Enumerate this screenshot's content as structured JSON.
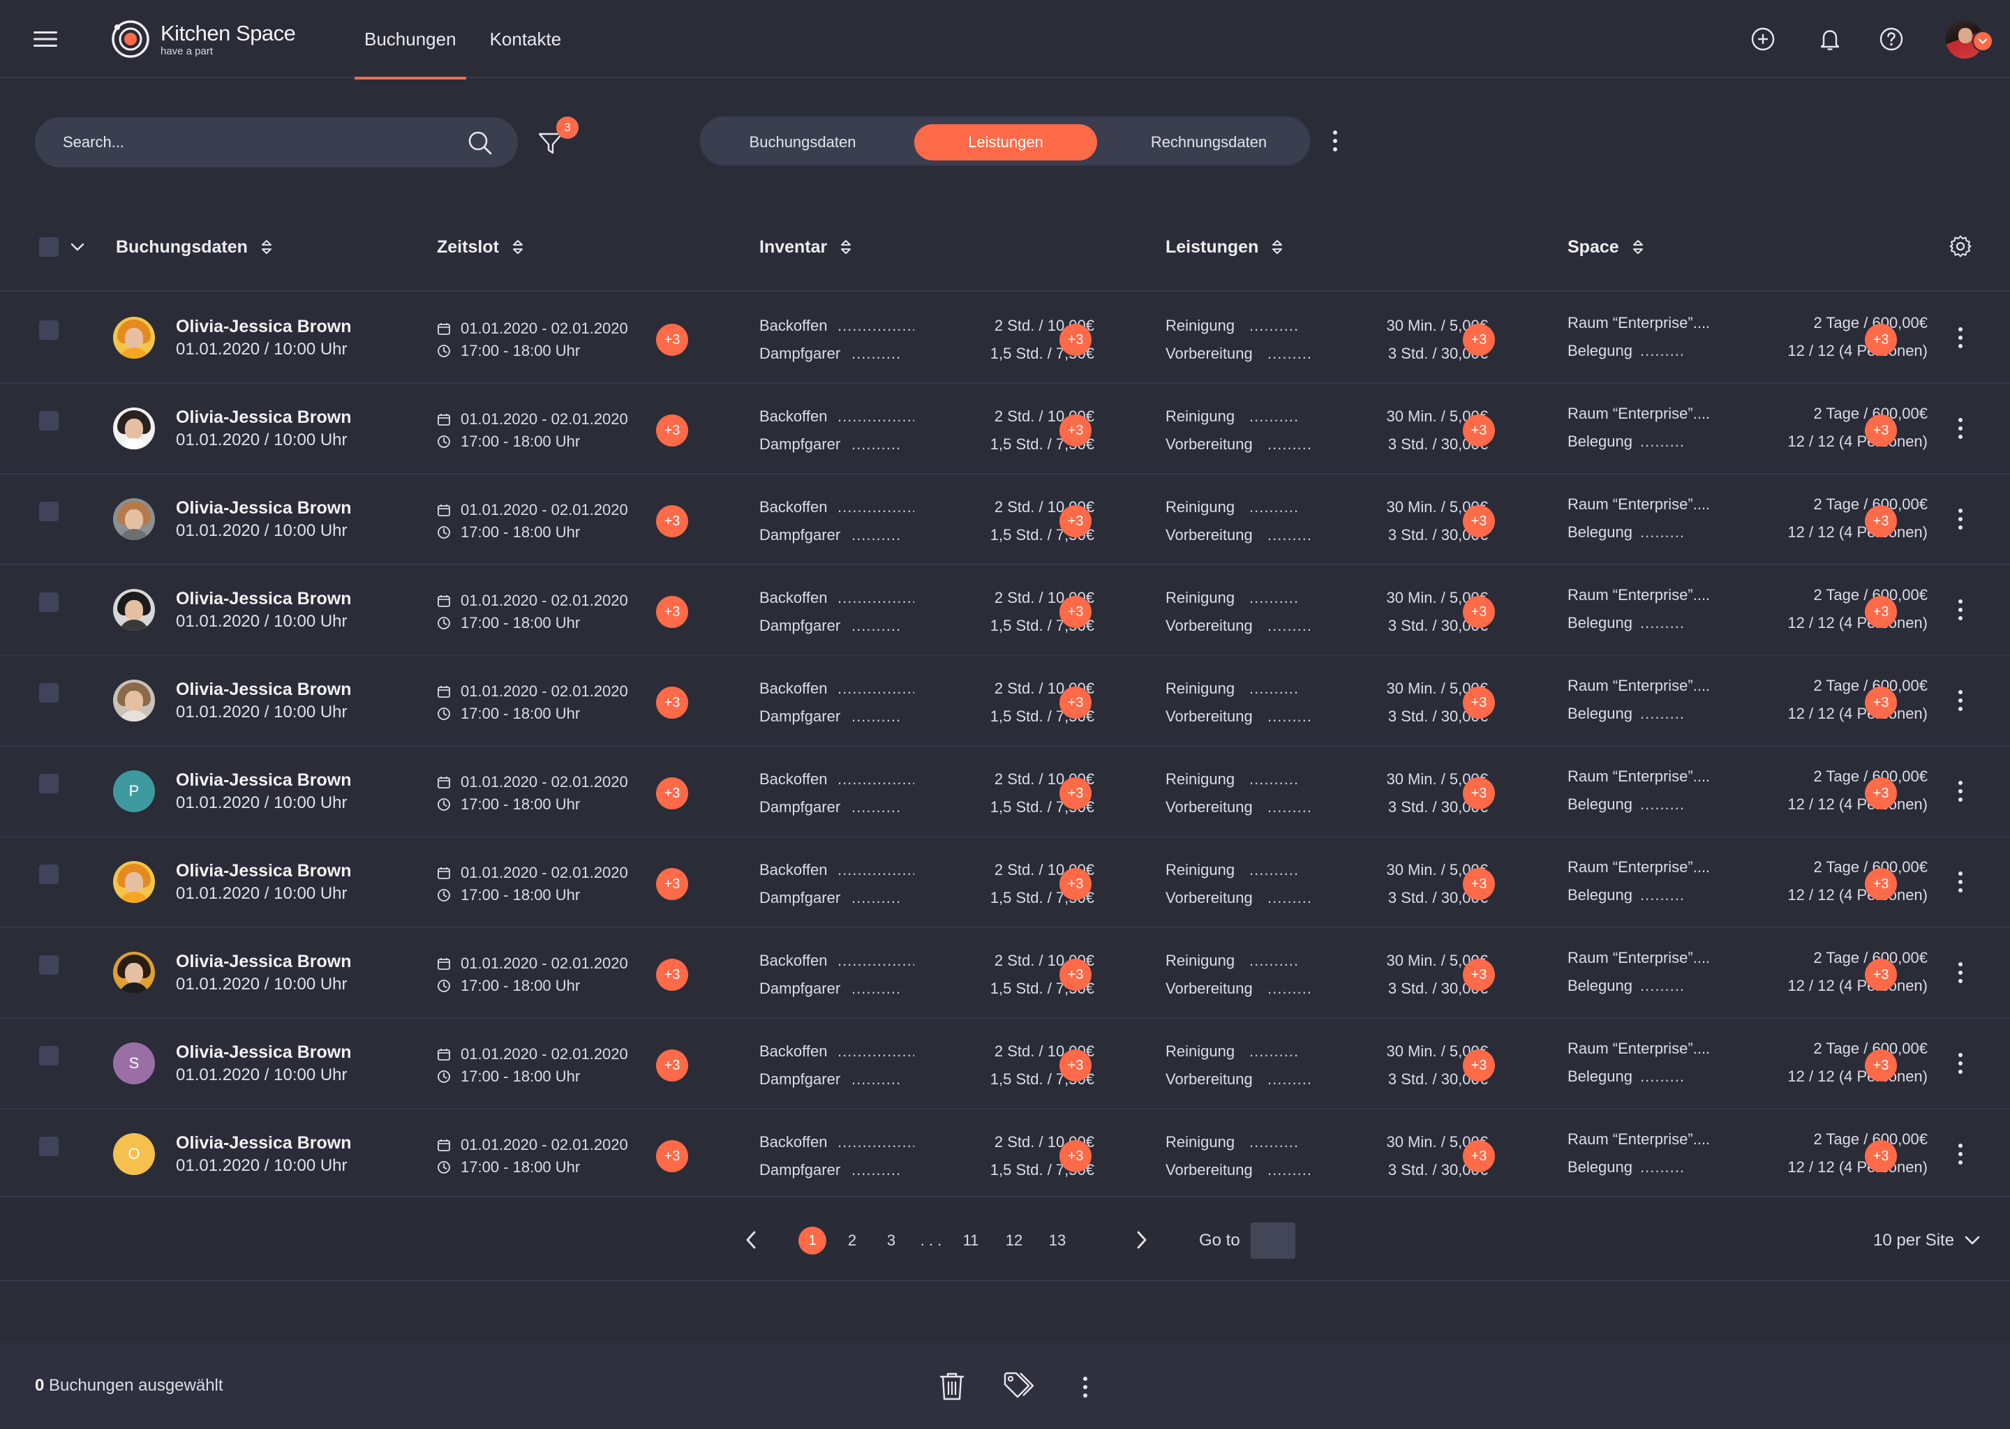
{
  "app": {
    "title": "Kitchen Space",
    "subtitle": "have a part",
    "accent_color": "#ff6a48",
    "background_color": "#2a2c38"
  },
  "nav": {
    "tabs": [
      {
        "label": "Buchungen",
        "active": true
      },
      {
        "label": "Kontakte",
        "active": false
      }
    ]
  },
  "header_icons": [
    "plus-circle-icon",
    "bell-icon",
    "help-icon",
    "user-avatar"
  ],
  "search": {
    "placeholder": "Search...",
    "value": ""
  },
  "filter": {
    "badge_count": "3"
  },
  "view_tabs": [
    {
      "label": "Buchungsdaten",
      "active": false
    },
    {
      "label": "Leistungen",
      "active": true
    },
    {
      "label": "Rechnungsdaten",
      "active": false
    }
  ],
  "columns": [
    "Buchungsdaten",
    "Zeitslot",
    "Inventar",
    "Leistungen",
    "Space"
  ],
  "rows": [
    {
      "name": "Olivia-Jessica Brown",
      "date": "01.01.2020  /  10:00 Uhr",
      "avatar": {
        "type": "photo",
        "hair": "#e58a1f",
        "bg": "#f3c54a",
        "body": "#f6a623"
      },
      "dates": "01.01.2020 - 02.01.2020",
      "time": "17:00 - 18:00 Uhr",
      "more_time": "+3",
      "inventar": [
        {
          "label": "Backoffen",
          "dots": "................",
          "value": "2 Std.  /  10,00€"
        },
        {
          "label": "Dampfgarer",
          "dots": "..........",
          "value": "1,5 Std.  /  7,50€"
        }
      ],
      "more_inventar": "+3",
      "leistungen": [
        {
          "label": "Reinigung",
          "dots": "..........",
          "value": "30 Min.  /  5,00€"
        },
        {
          "label": "Vorbereitung",
          "dots": ".........",
          "value": "3 Std.  /  30,00€"
        }
      ],
      "more_leistungen": "+3",
      "space": [
        {
          "label": "Raum “Enterprise”....",
          "dots": "",
          "value": "2 Tage  /  600,00€"
        },
        {
          "label": "Belegung",
          "dots": ".........",
          "value": "12 / 12 (4 Personen)"
        }
      ],
      "more_space": "+3"
    },
    {
      "name": "Olivia-Jessica Brown",
      "date": "01.01.2020  /  10:00 Uhr",
      "avatar": {
        "type": "photo",
        "hair": "#2a2220",
        "bg": "#f0f0f0",
        "body": "#ffffff"
      },
      "dates": "01.01.2020 - 02.01.2020",
      "time": "17:00 - 18:00 Uhr",
      "more_time": "+3",
      "inventar": [
        {
          "label": "Backoffen",
          "dots": "................",
          "value": "2 Std.  /  10,00€"
        },
        {
          "label": "Dampfgarer",
          "dots": "..........",
          "value": "1,5 Std.  /  7,50€"
        }
      ],
      "more_inventar": "+3",
      "leistungen": [
        {
          "label": "Reinigung",
          "dots": "..........",
          "value": "30 Min.  /  5,00€"
        },
        {
          "label": "Vorbereitung",
          "dots": ".........",
          "value": "3 Std.  /  30,00€"
        }
      ],
      "more_leistungen": "+3",
      "space": [
        {
          "label": "Raum “Enterprise”....",
          "dots": "",
          "value": "2 Tage  /  600,00€"
        },
        {
          "label": "Belegung",
          "dots": ".........",
          "value": "12 / 12 (4 Personen)"
        }
      ],
      "more_space": "+3"
    },
    {
      "name": "Olivia-Jessica Brown",
      "date": "01.01.2020  /  10:00 Uhr",
      "avatar": {
        "type": "photo",
        "hair": "#b57a4a",
        "bg": "#8a8f94",
        "body": "#6c6f74"
      },
      "dates": "01.01.2020 - 02.01.2020",
      "time": "17:00 - 18:00 Uhr",
      "more_time": "+3",
      "inventar": [
        {
          "label": "Backoffen",
          "dots": "................",
          "value": "2 Std.  /  10,00€"
        },
        {
          "label": "Dampfgarer",
          "dots": "..........",
          "value": "1,5 Std.  /  7,50€"
        }
      ],
      "more_inventar": "+3",
      "leistungen": [
        {
          "label": "Reinigung",
          "dots": "..........",
          "value": "30 Min.  /  5,00€"
        },
        {
          "label": "Vorbereitung",
          "dots": ".........",
          "value": "3 Std.  /  30,00€"
        }
      ],
      "more_leistungen": "+3",
      "space": [
        {
          "label": "Raum “Enterprise”....",
          "dots": "",
          "value": "2 Tage  /  600,00€"
        },
        {
          "label": "Belegung",
          "dots": ".........",
          "value": "12 / 12 (4 Personen)"
        }
      ],
      "more_space": "+3"
    },
    {
      "name": "Olivia-Jessica Brown",
      "date": "01.01.2020  /  10:00 Uhr",
      "avatar": {
        "type": "photo",
        "hair": "#1c1c1c",
        "bg": "#d7d7d7",
        "body": "#3a3a3a"
      },
      "dates": "01.01.2020 - 02.01.2020",
      "time": "17:00 - 18:00 Uhr",
      "more_time": "+3",
      "inventar": [
        {
          "label": "Backoffen",
          "dots": "................",
          "value": "2 Std.  /  10,00€"
        },
        {
          "label": "Dampfgarer",
          "dots": "..........",
          "value": "1,5 Std.  /  7,50€"
        }
      ],
      "more_inventar": "+3",
      "leistungen": [
        {
          "label": "Reinigung",
          "dots": "..........",
          "value": "30 Min.  /  5,00€"
        },
        {
          "label": "Vorbereitung",
          "dots": ".........",
          "value": "3 Std.  /  30,00€"
        }
      ],
      "more_leistungen": "+3",
      "space": [
        {
          "label": "Raum “Enterprise”....",
          "dots": "",
          "value": "2 Tage  /  600,00€"
        },
        {
          "label": "Belegung",
          "dots": ".........",
          "value": "12 / 12 (4 Personen)"
        }
      ],
      "more_space": "+3"
    },
    {
      "name": "Olivia-Jessica Brown",
      "date": "01.01.2020  /  10:00 Uhr",
      "avatar": {
        "type": "photo",
        "hair": "#8b6a4a",
        "bg": "#c9c2b8",
        "body": "#e6e1da"
      },
      "dates": "01.01.2020 - 02.01.2020",
      "time": "17:00 - 18:00 Uhr",
      "more_time": "+3",
      "inventar": [
        {
          "label": "Backoffen",
          "dots": "................",
          "value": "2 Std.  /  10,00€"
        },
        {
          "label": "Dampfgarer",
          "dots": "..........",
          "value": "1,5 Std.  /  7,50€"
        }
      ],
      "more_inventar": "+3",
      "leistungen": [
        {
          "label": "Reinigung",
          "dots": "..........",
          "value": "30 Min.  /  5,00€"
        },
        {
          "label": "Vorbereitung",
          "dots": ".........",
          "value": "3 Std.  /  30,00€"
        }
      ],
      "more_leistungen": "+3",
      "space": [
        {
          "label": "Raum “Enterprise”....",
          "dots": "",
          "value": "2 Tage  /  600,00€"
        },
        {
          "label": "Belegung",
          "dots": ".........",
          "value": "12 / 12 (4 Personen)"
        }
      ],
      "more_space": "+3"
    },
    {
      "name": "Olivia-Jessica Brown",
      "date": "01.01.2020  /  10:00 Uhr",
      "avatar": {
        "type": "initial",
        "initial": "P",
        "bg": "#3f9aa0"
      },
      "dates": "01.01.2020 - 02.01.2020",
      "time": "17:00 - 18:00 Uhr",
      "more_time": "+3",
      "inventar": [
        {
          "label": "Backoffen",
          "dots": "................",
          "value": "2 Std.  /  10,00€"
        },
        {
          "label": "Dampfgarer",
          "dots": "..........",
          "value": "1,5 Std.  /  7,50€"
        }
      ],
      "more_inventar": "+3",
      "leistungen": [
        {
          "label": "Reinigung",
          "dots": "..........",
          "value": "30 Min.  /  5,00€"
        },
        {
          "label": "Vorbereitung",
          "dots": ".........",
          "value": "3 Std.  /  30,00€"
        }
      ],
      "more_leistungen": "+3",
      "space": [
        {
          "label": "Raum “Enterprise”....",
          "dots": "",
          "value": "2 Tage  /  600,00€"
        },
        {
          "label": "Belegung",
          "dots": ".........",
          "value": "12 / 12 (4 Personen)"
        }
      ],
      "more_space": "+3"
    },
    {
      "name": "Olivia-Jessica Brown",
      "date": "01.01.2020  /  10:00 Uhr",
      "avatar": {
        "type": "photo",
        "hair": "#e58a1f",
        "bg": "#f3c54a",
        "body": "#f6a623"
      },
      "dates": "01.01.2020 - 02.01.2020",
      "time": "17:00 - 18:00 Uhr",
      "more_time": "+3",
      "inventar": [
        {
          "label": "Backoffen",
          "dots": "................",
          "value": "2 Std.  /  10,00€"
        },
        {
          "label": "Dampfgarer",
          "dots": "..........",
          "value": "1,5 Std.  /  7,50€"
        }
      ],
      "more_inventar": "+3",
      "leistungen": [
        {
          "label": "Reinigung",
          "dots": "..........",
          "value": "30 Min.  /  5,00€"
        },
        {
          "label": "Vorbereitung",
          "dots": ".........",
          "value": "3 Std.  /  30,00€"
        }
      ],
      "more_leistungen": "+3",
      "space": [
        {
          "label": "Raum “Enterprise”....",
          "dots": "",
          "value": "2 Tage  /  600,00€"
        },
        {
          "label": "Belegung",
          "dots": ".........",
          "value": "12 / 12 (4 Personen)"
        }
      ],
      "more_space": "+3"
    },
    {
      "name": "Olivia-Jessica Brown",
      "date": "01.01.2020  /  10:00 Uhr",
      "avatar": {
        "type": "photo",
        "hair": "#2a1e14",
        "bg": "#e0a030",
        "body": "#1d1d1d"
      },
      "dates": "01.01.2020 - 02.01.2020",
      "time": "17:00 - 18:00 Uhr",
      "more_time": "+3",
      "inventar": [
        {
          "label": "Backoffen",
          "dots": "................",
          "value": "2 Std.  /  10,00€"
        },
        {
          "label": "Dampfgarer",
          "dots": "..........",
          "value": "1,5 Std.  /  7,50€"
        }
      ],
      "more_inventar": "+3",
      "leistungen": [
        {
          "label": "Reinigung",
          "dots": "..........",
          "value": "30 Min.  /  5,00€"
        },
        {
          "label": "Vorbereitung",
          "dots": ".........",
          "value": "3 Std.  /  30,00€"
        }
      ],
      "more_leistungen": "+3",
      "space": [
        {
          "label": "Raum “Enterprise”....",
          "dots": "",
          "value": "2 Tage  /  600,00€"
        },
        {
          "label": "Belegung",
          "dots": ".........",
          "value": "12 / 12 (4 Personen)"
        }
      ],
      "more_space": "+3"
    },
    {
      "name": "Olivia-Jessica Brown",
      "date": "01.01.2020  /  10:00 Uhr",
      "avatar": {
        "type": "initial",
        "initial": "S",
        "bg": "#9a6fa6"
      },
      "dates": "01.01.2020 - 02.01.2020",
      "time": "17:00 - 18:00 Uhr",
      "more_time": "+3",
      "inventar": [
        {
          "label": "Backoffen",
          "dots": "................",
          "value": "2 Std.  /  10,00€"
        },
        {
          "label": "Dampfgarer",
          "dots": "..........",
          "value": "1,5 Std.  /  7,50€"
        }
      ],
      "more_inventar": "+3",
      "leistungen": [
        {
          "label": "Reinigung",
          "dots": "..........",
          "value": "30 Min.  /  5,00€"
        },
        {
          "label": "Vorbereitung",
          "dots": ".........",
          "value": "3 Std.  /  30,00€"
        }
      ],
      "more_leistungen": "+3",
      "space": [
        {
          "label": "Raum “Enterprise”....",
          "dots": "",
          "value": "2 Tage  /  600,00€"
        },
        {
          "label": "Belegung",
          "dots": ".........",
          "value": "12 / 12 (4 Personen)"
        }
      ],
      "more_space": "+3"
    },
    {
      "name": "Olivia-Jessica Brown",
      "date": "01.01.2020  /  10:00 Uhr",
      "avatar": {
        "type": "initial",
        "initial": "O",
        "bg": "#f6c04e"
      },
      "dates": "01.01.2020 - 02.01.2020",
      "time": "17:00 - 18:00 Uhr",
      "more_time": "+3",
      "inventar": [
        {
          "label": "Backoffen",
          "dots": "................",
          "value": "2 Std.  /  10,00€"
        },
        {
          "label": "Dampfgarer",
          "dots": "..........",
          "value": "1,5 Std.  /  7,50€"
        }
      ],
      "more_inventar": "+3",
      "leistungen": [
        {
          "label": "Reinigung",
          "dots": "..........",
          "value": "30 Min.  /  5,00€"
        },
        {
          "label": "Vorbereitung",
          "dots": ".........",
          "value": "3 Std.  /  30,00€"
        }
      ],
      "more_leistungen": "+3",
      "space": [
        {
          "label": "Raum “Enterprise”....",
          "dots": "",
          "value": "2 Tage  /  600,00€"
        },
        {
          "label": "Belegung",
          "dots": ".........",
          "value": "12 / 12 (4 Personen)"
        }
      ],
      "more_space": "+3"
    }
  ],
  "pagination": {
    "pages": [
      "1",
      "2",
      "3",
      ". . .",
      "11",
      "12",
      "13"
    ],
    "current": "1",
    "goto_label": "Go to",
    "goto_value": "",
    "per_page": "10 per Site"
  },
  "footer": {
    "selected_count": "0",
    "selected_label": " Buchungen ausgewählt"
  }
}
